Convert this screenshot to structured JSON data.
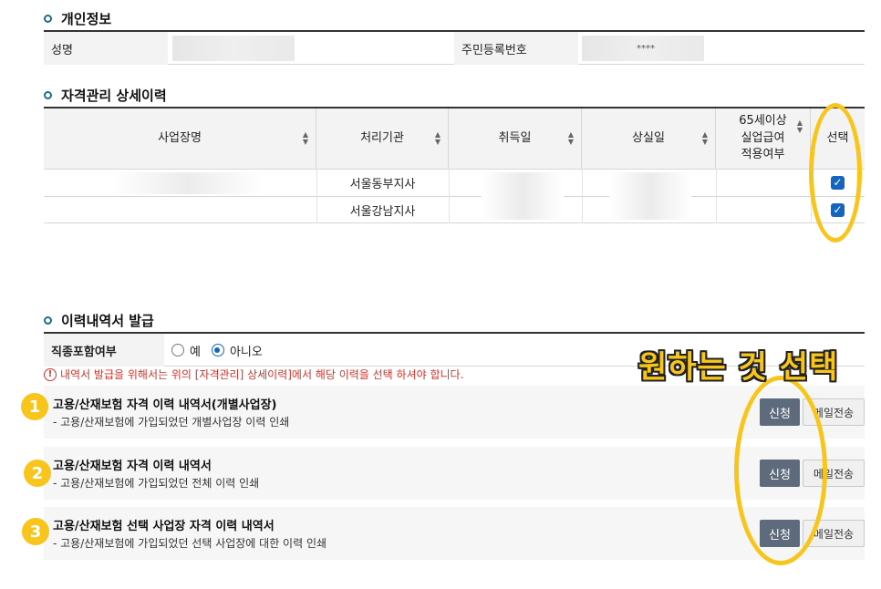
{
  "personal_info": {
    "section_title": "개인정보",
    "name_label": "성명",
    "rrn_label": "주민등록번호",
    "rrn_value": "****"
  },
  "detail_history": {
    "section_title": "자격관리 상세이력",
    "columns": [
      "사업장명",
      "처리기관",
      "취득일",
      "상실일",
      "65세이상\n실업급여\n적용여부",
      "선택"
    ],
    "rows": [
      {
        "agency": "서울동부지사",
        "checked": true
      },
      {
        "agency": "서울강남지사",
        "checked": true
      }
    ]
  },
  "issuance": {
    "section_title": "이력내역서 발급",
    "job_label": "직종포함여부",
    "opt_yes": "예",
    "opt_no": "아니오",
    "selected": "아니오",
    "warning": "내역서 발급을 위해서는 위의 [자격관리] 상세이력]에서 해당 이력을 선택 하셔야 합니다.",
    "warning_icon": "exclamation-icon",
    "documents": [
      {
        "number": "1",
        "title": "고용/산재보험 자격 이력 내역서(개별사업장)",
        "desc": "- 고용/산재보험에 가입되었던 개별사업장 이력 인쇄",
        "apply": "신청",
        "mail": "메일전송"
      },
      {
        "number": "2",
        "title": "고용/산재보험 자격 이력 내역서",
        "desc": "- 고용/산재보험에 가입되었던 전체 이력 인쇄",
        "apply": "신청",
        "mail": "메일전송"
      },
      {
        "number": "3",
        "title": "고용/산재보험 선택 사업장 자격 이력 내역서",
        "desc": "- 고용/산재보험에 가입되었던 선택 사업장에 대한 이력 인쇄",
        "apply": "신청",
        "mail": "메일전송"
      }
    ]
  },
  "annotation": {
    "text": "원하는 것 선택",
    "color": "#f7c51b"
  }
}
